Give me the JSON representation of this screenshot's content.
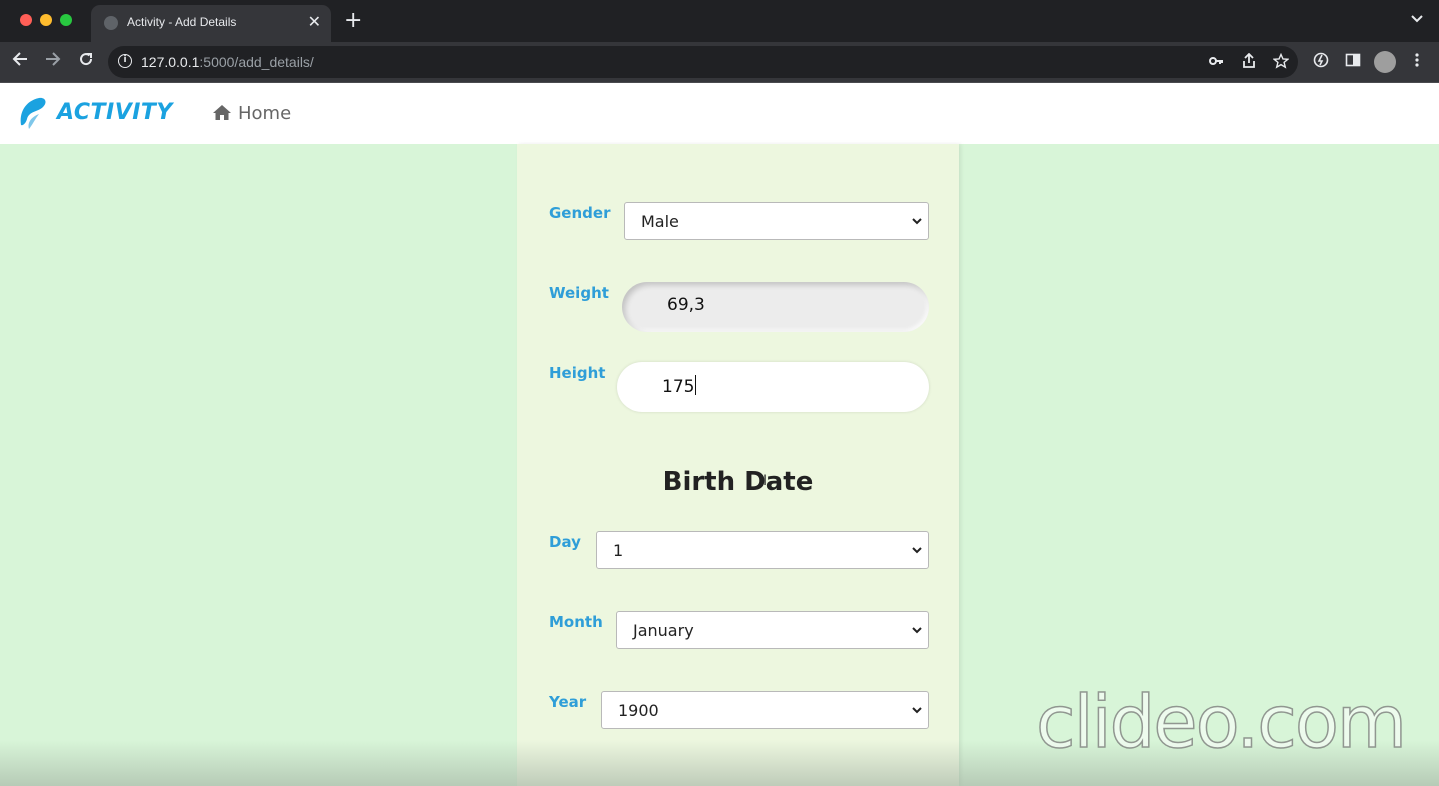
{
  "browser": {
    "tab_title": "Activity - Add Details",
    "url_host": "127.0.0.1",
    "url_path": ":5000/add_details/"
  },
  "site": {
    "logo_text": "ACTIVITY",
    "nav_home": "Home",
    "brand_color": "#1ba2e0"
  },
  "form": {
    "gender_label": "Gender",
    "gender_value": "Male",
    "weight_label": "Weight",
    "weight_value": "69,3",
    "height_label": "Height",
    "height_value": "175",
    "birth_date_title": "Birth Date",
    "day_label": "Day",
    "day_value": "1",
    "month_label": "Month",
    "month_value": "January",
    "year_label": "Year",
    "year_value": "1900",
    "label_color": "#2f9ed8"
  },
  "watermark": "clideo.com"
}
